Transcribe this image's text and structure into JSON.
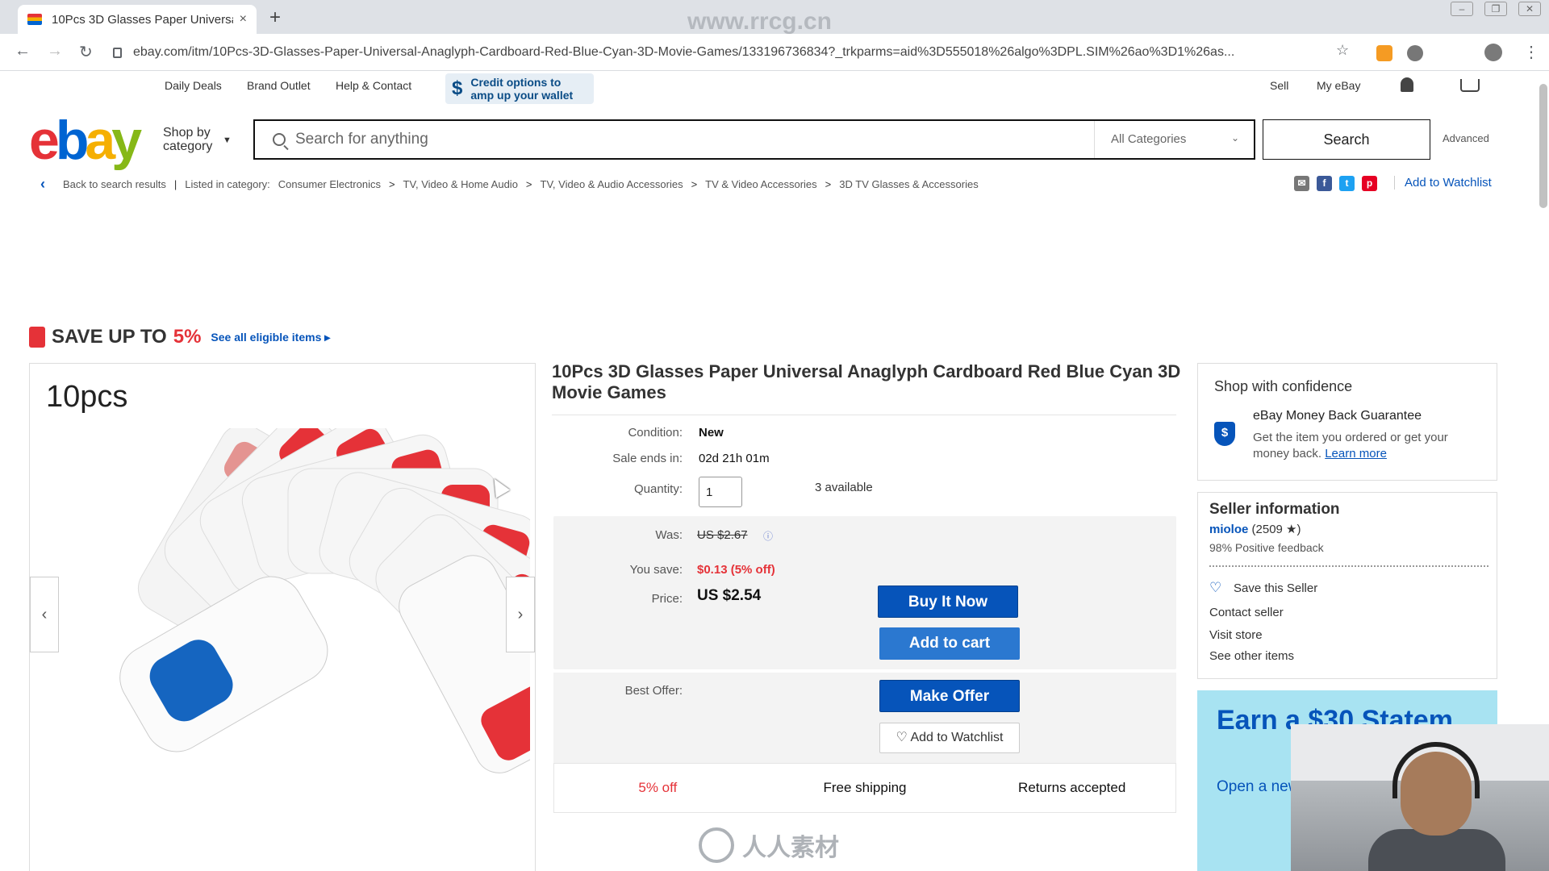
{
  "browser": {
    "tab_title": "10Pcs 3D Glasses Paper Universa",
    "tab_close": "×",
    "new_tab": "+",
    "url": "ebay.com/itm/10Pcs-3D-Glasses-Paper-Universal-Anaglyph-Cardboard-Red-Blue-Cyan-3D-Movie-Games/133196736834?_trkparms=aid%3D555018%26algo%3DPL.SIM%26ao%3D1%26as...",
    "watermark_top": "www.rrcg.cn"
  },
  "topnav": {
    "daily_deals": "Daily Deals",
    "brand_outlet": "Brand Outlet",
    "help": "Help & Contact",
    "credit_line1": "Credit options to",
    "credit_line2": "amp up your wallet",
    "credit_symbol": "$",
    "sell": "Sell",
    "my_ebay": "My eBay"
  },
  "header": {
    "logo": {
      "e": "e",
      "b": "b",
      "a": "a",
      "y": "y"
    },
    "shop_by_line1": "Shop by",
    "shop_by_line2": "category",
    "search_placeholder": "Search for anything",
    "category": "All Categories",
    "search_button": "Search",
    "advanced": "Advanced"
  },
  "breadcrumb": {
    "back": "Back to search results",
    "listed": "Listed in category:",
    "items": [
      "Consumer Electronics",
      "TV, Video & Home Audio",
      "TV, Video & Audio Accessories",
      "TV & Video Accessories",
      "3D TV Glasses & Accessories"
    ],
    "separator": ">",
    "add_to_watchlist": "Add to Watchlist"
  },
  "promo_banner": {
    "save_text": "SAVE UP TO",
    "save_pct": "5%",
    "see_all": "See all eligible items ▸"
  },
  "gallery": {
    "label": "10pcs",
    "prev": "‹",
    "next": "›"
  },
  "product": {
    "title": "10Pcs 3D Glasses Paper Universal Anaglyph Cardboard Red Blue Cyan 3D Movie Games",
    "condition_label": "Condition:",
    "condition": "New",
    "sale_ends_label": "Sale ends in:",
    "sale_ends": "02d 21h 01m",
    "quantity_label": "Quantity:",
    "quantity": "1",
    "available": "3 available",
    "was_label": "Was:",
    "was": "US $2.67",
    "you_save_label": "You save:",
    "you_save": "$0.13 (5% off)",
    "price_label": "Price:",
    "price": "US $2.54",
    "buy_now": "Buy It Now",
    "add_to_cart": "Add to cart",
    "best_offer_label": "Best Offer:",
    "make_offer": "Make Offer",
    "add_to_watchlist": "♡ Add to Watchlist",
    "perk_discount": "5% off",
    "perk_shipping": "Free shipping",
    "perk_returns": "Returns accepted"
  },
  "confidence": {
    "heading": "Shop with confidence",
    "guarantee_title": "eBay Money Back Guarantee",
    "guarantee_text": "Get the item you ordered or get your money back.",
    "learn_more": "Learn more",
    "shield": "$"
  },
  "seller": {
    "heading": "Seller information",
    "name": "mioloe",
    "score": "(2509 ★)",
    "feedback": "98% Positive feedback",
    "save_seller": "Save this Seller",
    "contact": "Contact seller",
    "visit_store": "Visit store",
    "other_items": "See other items"
  },
  "ad": {
    "headline": "Earn a $30 Statem",
    "sub": "Open a new account and within 30 d"
  },
  "watermark": {
    "text": "人人素材"
  },
  "colors": {
    "ebay_red": "#e53238",
    "ebay_blue": "#0064d2",
    "ebay_yellow": "#f5af02",
    "ebay_green": "#86b817",
    "link_blue": "#0654ba",
    "save_red": "#e53238"
  }
}
